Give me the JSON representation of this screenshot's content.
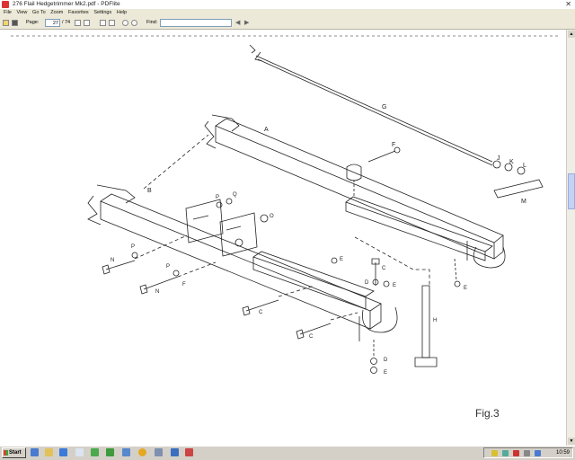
{
  "window": {
    "title": "276 Flail Hedgetrimmer Mk2.pdf - PDFlite"
  },
  "menu": {
    "items": [
      "File",
      "View",
      "Go To",
      "Zoom",
      "Favorites",
      "Settings",
      "Help"
    ]
  },
  "toolbar": {
    "page_label": "Page:",
    "page_current": "27",
    "page_total": "74",
    "find_label": "Find:",
    "find_value": ""
  },
  "diagram": {
    "figure_label": "Fig.3",
    "part_labels": [
      "A",
      "B",
      "C",
      "D",
      "E",
      "F",
      "G",
      "H",
      "J",
      "K",
      "L",
      "M",
      "N",
      "O",
      "P",
      "Q"
    ]
  },
  "taskbar": {
    "start_label": "Start",
    "clock": "10:59"
  }
}
